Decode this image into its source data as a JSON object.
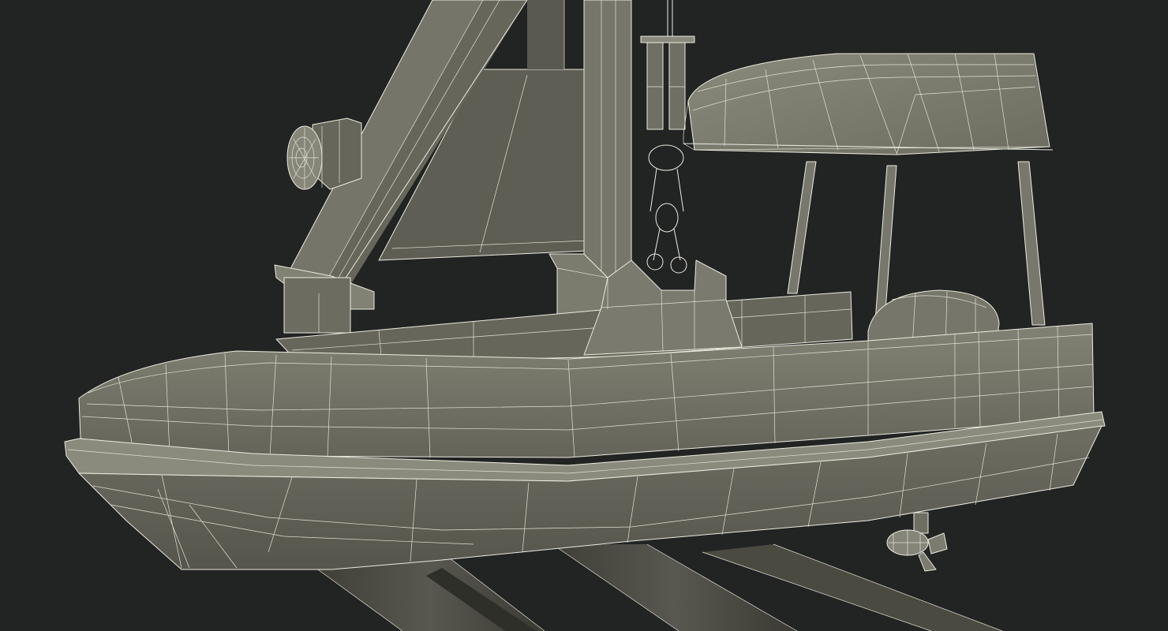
{
  "scene": {
    "subject": "boat-davit-wireframe",
    "colors": {
      "background": "#222323",
      "surface_light": "#7d7d70",
      "surface_mid": "#67675b",
      "surface_dark": "#4c4c43",
      "wire": "#ecebe0"
    }
  }
}
